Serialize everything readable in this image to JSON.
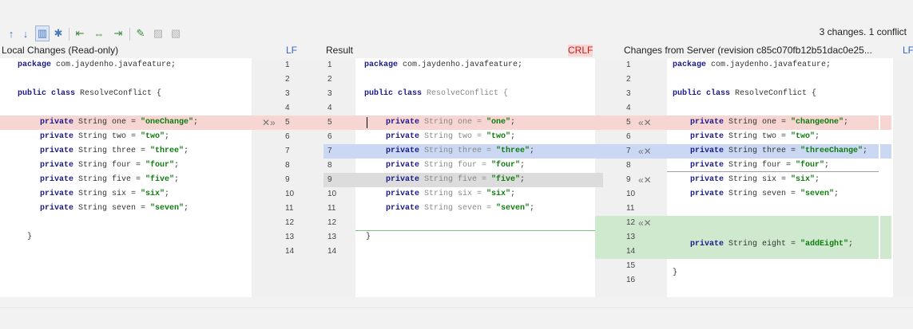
{
  "status": "3 changes. 1 conflict",
  "headers": {
    "left": "Local Changes (Read-only)",
    "left_lf": "LF",
    "middle": "Result",
    "middle_crlf": "CRLF",
    "right": "Changes from Server (revision c85c070fb12b51dac0e25...",
    "right_lf": "LF"
  },
  "toolbar": {
    "up": "↑",
    "down": "↓",
    "columns": "▥",
    "settings": "✱",
    "apply_left": "⇤",
    "apply_all": "⇔",
    "apply_right": "⇥",
    "magic": "✎",
    "accept_left": "▨",
    "accept_right": "▧"
  },
  "markers": {
    "left_accept": "✕»",
    "right_accept": "«✕"
  },
  "left_nums": [
    "1",
    "2",
    "3",
    "4",
    "5",
    "6",
    "7",
    "8",
    "9",
    "10",
    "11",
    "12",
    "13",
    "14"
  ],
  "result_nums": [
    "1",
    "2",
    "3",
    "4",
    "5",
    "6",
    "7",
    "8",
    "9",
    "10",
    "11",
    "12",
    "13",
    "14"
  ],
  "right_nums": [
    "1",
    "2",
    "3",
    "4",
    "5",
    "6",
    "7",
    "8",
    "9",
    "10",
    "11",
    "12",
    "13",
    "14",
    "15",
    "16"
  ],
  "left_code": {
    "l1": {
      "kw": "package",
      "rest": " com.jaydenho.javafeature;"
    },
    "l3": {
      "kw": "public class",
      "rest": " ResolveConflict {"
    },
    "l5": {
      "kw": "private",
      "rest": " String one = ",
      "str": "\"oneChange\"",
      "end": ";"
    },
    "l6": {
      "kw": "private",
      "rest": " String two = ",
      "str": "\"two\"",
      "end": ";"
    },
    "l7": {
      "kw": "private",
      "rest": " String three = ",
      "str": "\"three\"",
      "end": ";"
    },
    "l8": {
      "kw": "private",
      "rest": " String four = ",
      "str": "\"four\"",
      "end": ";"
    },
    "l9": {
      "kw": "private",
      "rest": " String five = ",
      "str": "\"five\"",
      "end": ";"
    },
    "l10": {
      "kw": "private",
      "rest": " String six = ",
      "str": "\"six\"",
      "end": ";"
    },
    "l11": {
      "kw": "private",
      "rest": " String seven = ",
      "str": "\"seven\"",
      "end": ";"
    },
    "l13": "}"
  },
  "mid_code": {
    "l1": {
      "kw": "package",
      "rest": " com.jaydenho.javafeature;"
    },
    "l3": {
      "kw": "public class",
      "rest": " ResolveConflict {"
    },
    "l5": {
      "kw": "private",
      "rest": " String one = ",
      "str": "\"one\"",
      "end": ";"
    },
    "l6": {
      "kw": "private",
      "rest": " String two = ",
      "str": "\"two\"",
      "end": ";"
    },
    "l7": {
      "kw": "private",
      "rest": " String three = ",
      "str": "\"three\"",
      "end": ";"
    },
    "l8": {
      "kw": "private",
      "rest": " String four = ",
      "str": "\"four\"",
      "end": ";"
    },
    "l9": {
      "kw": "private",
      "rest": " String five = ",
      "str": "\"five\"",
      "end": ";"
    },
    "l10": {
      "kw": "private",
      "rest": " String six = ",
      "str": "\"six\"",
      "end": ";"
    },
    "l11": {
      "kw": "private",
      "rest": " String seven = ",
      "str": "\"seven\"",
      "end": ";"
    },
    "l13": "}"
  },
  "right_code": {
    "l1": {
      "kw": "package",
      "rest": " com.jaydenho.javafeature;"
    },
    "l3": {
      "kw": "public class",
      "rest": " ResolveConflict {"
    },
    "l5": {
      "kw": "private",
      "rest": " String one = ",
      "str": "\"changeOne\"",
      "end": ";"
    },
    "l6": {
      "kw": "private",
      "rest": " String two = ",
      "str": "\"two\"",
      "end": ";"
    },
    "l7": {
      "kw": "private",
      "rest": " String three = ",
      "str": "\"threeChange\"",
      "end": ";"
    },
    "l8": {
      "kw": "private",
      "rest": " String four = ",
      "str": "\"four\"",
      "end": ";"
    },
    "l9": {
      "kw": "private",
      "rest": " String six = ",
      "str": "\"six\"",
      "end": ";"
    },
    "l10": {
      "kw": "private",
      "rest": " String seven = ",
      "str": "\"seven\"",
      "end": ";"
    },
    "l13": {
      "kw": "private",
      "rest": " String eight = ",
      "str": "\"addEight\"",
      "end": ";"
    },
    "l15": "}"
  }
}
